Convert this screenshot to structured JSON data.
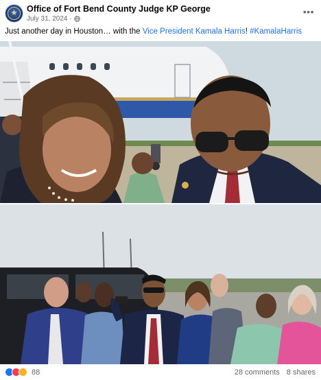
{
  "post": {
    "author": "Office of Fort Bend County Judge KP George",
    "date": "July 31, 2024",
    "date_separator": "·",
    "visibility_icon": "globe-icon",
    "more_icon": "more-options-icon",
    "caption": {
      "text_before": "Just another day in Houston… with the ",
      "mention": "Vice President Kamala Harris",
      "text_middle": "! ",
      "hashtag": "#KamalaHarris"
    }
  },
  "photos": [
    {
      "id": "selfie-photo",
      "description_icon": "photo"
    },
    {
      "id": "group-photo",
      "description_icon": "photo"
    }
  ],
  "footer": {
    "reaction_icons": [
      "like-icon",
      "love-icon",
      "care-icon"
    ],
    "reaction_count": "88",
    "comments": "28 comments",
    "shares": "8 shares"
  },
  "colors": {
    "link": "#216fdb",
    "secondary_text": "#65676b",
    "like": "#1877f2",
    "love": "#f33e58",
    "care": "#f7b125"
  }
}
